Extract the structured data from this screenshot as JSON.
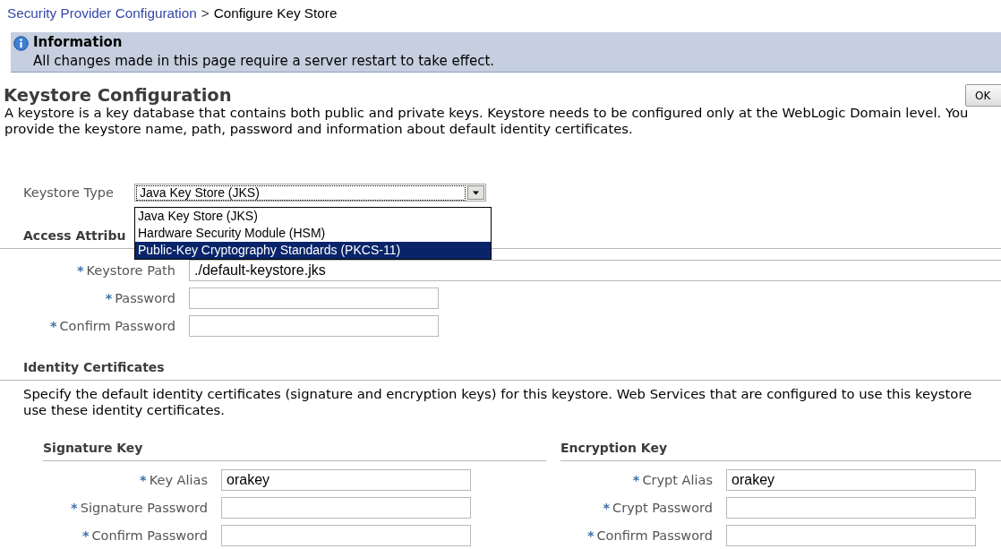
{
  "breadcrumb": {
    "link": "Security Provider Configuration",
    "separator": ">",
    "current": "Configure Key Store"
  },
  "info": {
    "title": "Information",
    "message": "All changes made in this page require a server restart to take effect."
  },
  "heading": "Keystore Configuration",
  "ok_button": "OK",
  "description": [
    "A keystore is a key database that contains both public and private keys. Keystore needs to be configured only at the WebLogic Domain level. You",
    "provide the keystore name, path, password and information about default identity certificates."
  ],
  "keystore_type": {
    "label": "Keystore Type",
    "value": "Java Key Store (JKS)",
    "expanded": true,
    "options": [
      {
        "label": "Java Key Store (JKS)",
        "highlighted": false
      },
      {
        "label": "Hardware Security Module (HSM)",
        "highlighted": false
      },
      {
        "label": "Public-Key Cryptography Standards (PKCS-11)",
        "highlighted": true
      }
    ]
  },
  "access_attributes": {
    "heading": "Access Attribu",
    "fields": [
      {
        "marker": "*",
        "label": "Keystore Path",
        "value": "./default-keystore.jks"
      },
      {
        "marker": "*",
        "label": "Password"
      },
      {
        "marker": "*",
        "label": "Confirm Password"
      }
    ]
  },
  "identity_certificates": {
    "heading": "Identity Certificates",
    "description": [
      "Specify the default identity certificates (signature and encryption keys) for this keystore. Web Services that are configured to use this keystore",
      "use these identity certificates."
    ],
    "groups": [
      {
        "heading": "Signature Key",
        "fields": [
          {
            "marker": "*",
            "label": "Key Alias",
            "value": "orakey"
          },
          {
            "marker": "*",
            "label": "Signature Password"
          },
          {
            "marker": "*",
            "label": "Confirm Password"
          }
        ]
      },
      {
        "heading": "Encryption Key",
        "fields": [
          {
            "marker": "*",
            "label": "Crypt Alias",
            "value": "orakey"
          },
          {
            "marker": "*",
            "label": "Crypt Password"
          },
          {
            "marker": "*",
            "label": "Confirm Password"
          }
        ]
      }
    ]
  }
}
